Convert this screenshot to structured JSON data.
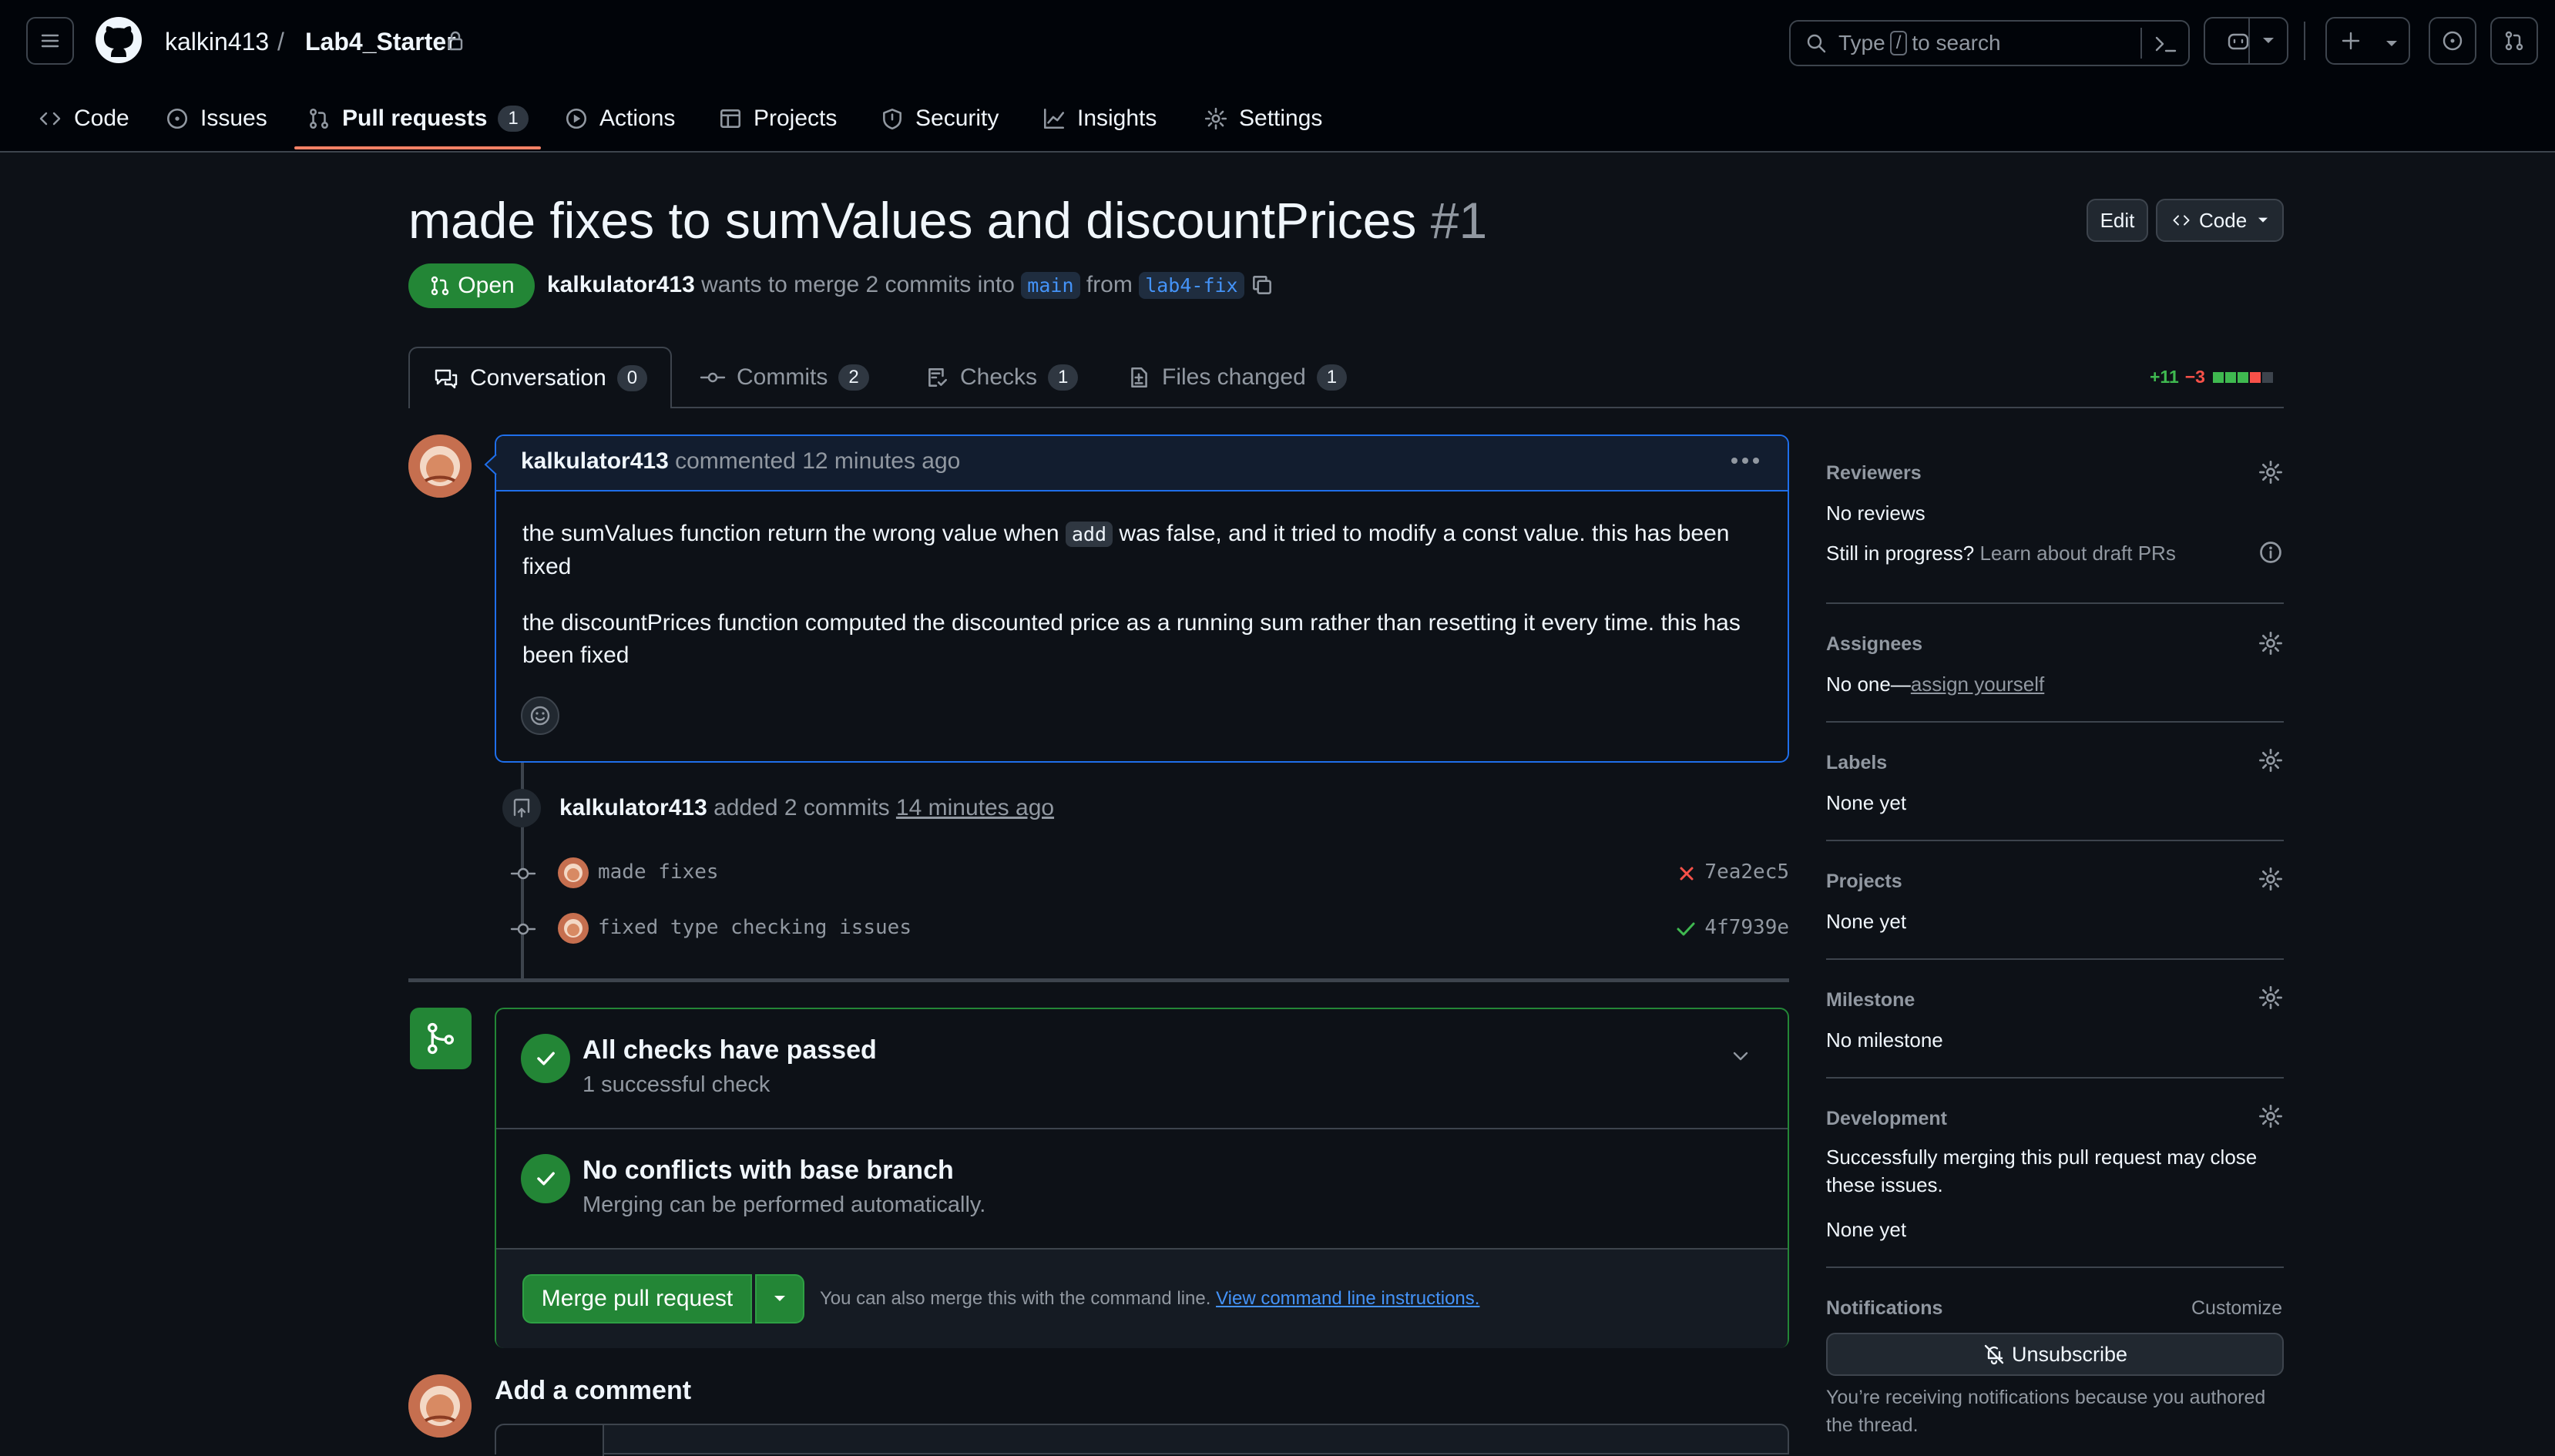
{
  "header": {
    "owner": "kalkin413",
    "separator": "/",
    "repo": "Lab4_Starter",
    "search_prefix": "Type",
    "search_key": "/",
    "search_suffix": "to search"
  },
  "nav": {
    "code": "Code",
    "issues": "Issues",
    "pulls": "Pull requests",
    "pulls_count": "1",
    "actions": "Actions",
    "projects": "Projects",
    "security": "Security",
    "insights": "Insights",
    "settings": "Settings"
  },
  "pr": {
    "title": "made fixes to sumValues and discountPrices",
    "number": "#1",
    "edit_label": "Edit",
    "code_label": "Code",
    "state": "Open",
    "author": "kalkulator413",
    "merge_text_1": "wants to merge 2 commits into",
    "base": "main",
    "merge_text_2": "from",
    "head": "lab4-fix"
  },
  "tabs": {
    "conversation": "Conversation",
    "conversation_count": "0",
    "commits": "Commits",
    "commits_count": "2",
    "checks": "Checks",
    "checks_count": "1",
    "files": "Files changed",
    "files_count": "1",
    "additions": "+11",
    "deletions": "−3"
  },
  "comment": {
    "author": "kalkulator413",
    "action": "commented",
    "time": "12 minutes ago",
    "p1_a": "the sumValues function return the wrong value when",
    "p1_code": "add",
    "p1_b": "was false, and it tried to modify a const value. this has been",
    "p1_c": "fixed",
    "p2_a": "the discountPrices function computed the discounted price as a running sum rather than resetting it every time. this has",
    "p2_b": "been fixed"
  },
  "commits_event": {
    "author": "kalkulator413",
    "text": "added 2 commits",
    "time": "14 minutes ago",
    "items": [
      {
        "message": "made fixes",
        "sha": "7ea2ec5",
        "status": "failed"
      },
      {
        "message": "fixed type checking issues",
        "sha": "4f7939e",
        "status": "passed"
      }
    ]
  },
  "merge": {
    "checks_title": "All checks have passed",
    "checks_sub": "1 successful check",
    "conflicts_title": "No conflicts with base branch",
    "conflicts_sub": "Merging can be performed automatically.",
    "button": "Merge pull request",
    "hint": "You can also merge this with the command line.",
    "link": "View command line instructions."
  },
  "add_comment": "Add a comment",
  "sidebar": {
    "reviewers_h": "Reviewers",
    "reviewers_v": "No reviews",
    "draft_q": "Still in progress?",
    "draft_link": "Learn about draft PRs",
    "assignees_h": "Assignees",
    "assignees_v": "No one—",
    "assign_link": "assign yourself",
    "labels_h": "Labels",
    "labels_v": "None yet",
    "projects_h": "Projects",
    "projects_v": "None yet",
    "milestone_h": "Milestone",
    "milestone_v": "No milestone",
    "development_h": "Development",
    "development_t1": "Successfully merging this pull request may close",
    "development_t2": "these issues.",
    "development_v": "None yet",
    "notifications_h": "Notifications",
    "customize": "Customize",
    "unsubscribe": "Unsubscribe",
    "notif_t1": "You’re receiving notifications because you authored",
    "notif_t2": "the thread."
  },
  "colors": {
    "accent_green": "#238636",
    "accent_blue": "#4493f8",
    "danger": "#f85149",
    "tab_underline": "#f78166"
  }
}
